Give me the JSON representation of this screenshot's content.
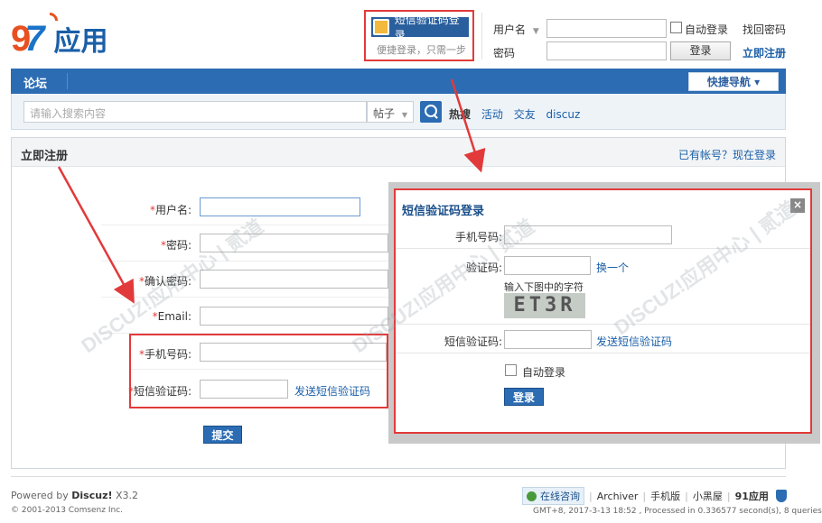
{
  "header": {
    "logo_num": "9",
    "logo_tail": "7",
    "logo_text": "应用",
    "sms_login_label": "短信验证码登录",
    "sms_login_hint": "便捷登录，只需一步",
    "username_label": "用户名",
    "password_label": "密码",
    "auto_login_label": "自动登录",
    "find_password": "找回密码",
    "login_button": "登录",
    "register_link": "立即注册"
  },
  "nav": {
    "title": "论坛",
    "quick_nav": "快捷导航 ▾"
  },
  "search": {
    "placeholder": "请输入搜索内容",
    "type": "帖子",
    "hot_label": "热搜",
    "hot_keywords": [
      "活动",
      "交友",
      "discuz"
    ]
  },
  "register": {
    "title": "立即注册",
    "login_link": "已有帐号？现在登录",
    "fields": [
      {
        "label": "用户名:"
      },
      {
        "label": "密码:"
      },
      {
        "label": "确认密码:"
      },
      {
        "label": "Email:"
      },
      {
        "label": "手机号码:"
      },
      {
        "label": "短信验证码:"
      }
    ],
    "send_sms": "发送短信验证码",
    "submit": "提交"
  },
  "modal": {
    "title": "短信验证码登录",
    "close": "×",
    "phone_label": "手机号码:",
    "captcha_label": "验证码:",
    "captcha_change": "换一个",
    "captcha_hint": "输入下图中的字符",
    "captcha_text": "ET3R",
    "sms_label": "短信验证码:",
    "send_sms": "发送短信验证码",
    "auto_login": "自动登录",
    "login_button": "登录"
  },
  "watermark": "DISCUZ!应用中心 | 贰道",
  "footer": {
    "powered_prefix": "Powered by ",
    "powered_brand": "Discuz!",
    "powered_version": " X3.2",
    "copyright": "© 2001-2013 Comsenz Inc.",
    "online": "在线咨询",
    "links": [
      "Archiver",
      "手机版",
      "小黑屋",
      "91应用"
    ],
    "status": "GMT+8, 2017-3-13 18:52 , Processed in 0.336577 second(s), 8 queries ."
  },
  "colors": {
    "accent": "#2c6cb3",
    "highlight": "#e23a3a"
  }
}
